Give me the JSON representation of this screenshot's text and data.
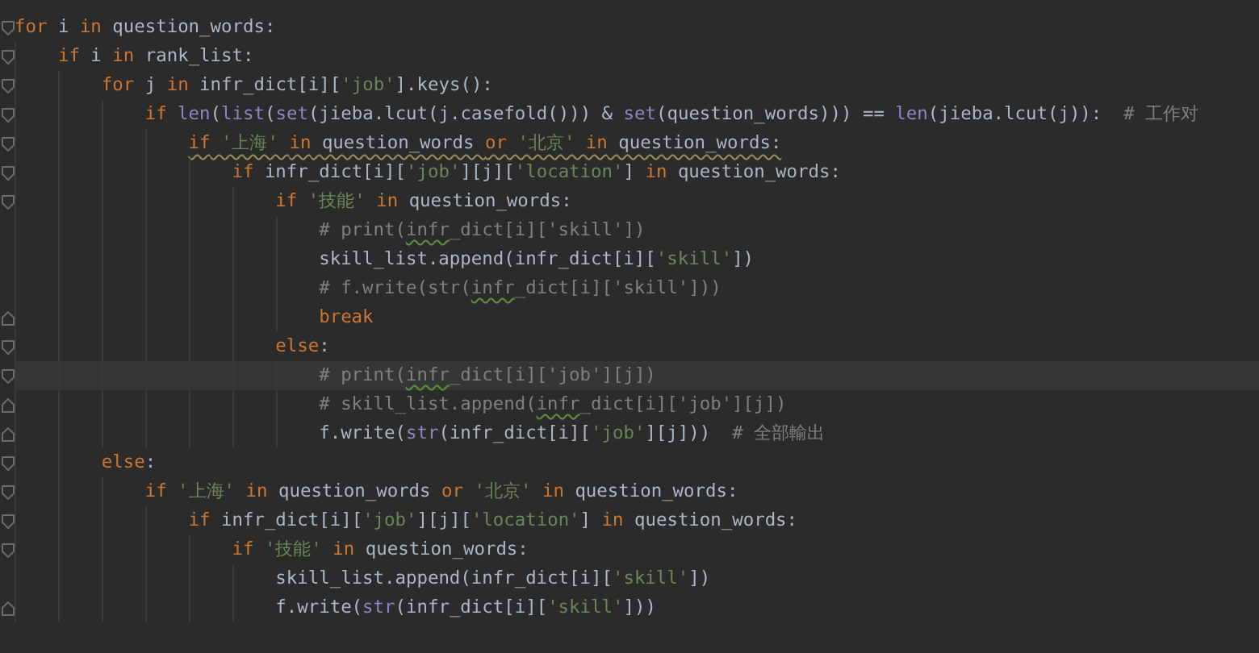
{
  "editor": {
    "lines": [
      {
        "fold_open": true,
        "fold_close": false,
        "tokens": [
          {
            "kind": "kw",
            "text": "for"
          },
          {
            "kind": "id",
            "text": " i "
          },
          {
            "kind": "kw",
            "text": "in"
          },
          {
            "kind": "id",
            "text": " question_words:"
          }
        ]
      },
      {
        "fold_open": true,
        "fold_close": false,
        "tokens": [
          {
            "kind": "kw",
            "text": "    if"
          },
          {
            "kind": "id",
            "text": " i "
          },
          {
            "kind": "kw",
            "text": "in"
          },
          {
            "kind": "id",
            "text": " rank_list:"
          }
        ]
      },
      {
        "fold_open": true,
        "fold_close": false,
        "tokens": [
          {
            "kind": "kw",
            "text": "        for"
          },
          {
            "kind": "id",
            "text": " j "
          },
          {
            "kind": "kw",
            "text": "in"
          },
          {
            "kind": "id",
            "text": " infr_dict[i]["
          },
          {
            "kind": "str",
            "text": "'job'"
          },
          {
            "kind": "id",
            "text": "].keys():"
          }
        ]
      },
      {
        "fold_open": true,
        "fold_close": false,
        "tokens": [
          {
            "kind": "kw",
            "text": "            if"
          },
          {
            "kind": "builtin",
            "text": " len"
          },
          {
            "kind": "id",
            "text": "("
          },
          {
            "kind": "builtin",
            "text": "list"
          },
          {
            "kind": "id",
            "text": "("
          },
          {
            "kind": "builtin",
            "text": "set"
          },
          {
            "kind": "id",
            "text": "(jieba.lcut(j.casefold())) & "
          },
          {
            "kind": "builtin",
            "text": "set"
          },
          {
            "kind": "id",
            "text": "(question_words))) == "
          },
          {
            "kind": "builtin",
            "text": "len"
          },
          {
            "kind": "id",
            "text": "(jieba.lcut(j)):  "
          },
          {
            "kind": "comment",
            "text": "# 工作对"
          }
        ]
      },
      {
        "fold_open": true,
        "fold_close": false,
        "warning": true,
        "tokens": [
          {
            "kind": "kw",
            "text": "                if"
          },
          {
            "kind": "str",
            "text": " '上海' "
          },
          {
            "kind": "kw",
            "text": "in"
          },
          {
            "kind": "id",
            "text": " question_words "
          },
          {
            "kind": "kw",
            "text": "or"
          },
          {
            "kind": "str",
            "text": " '北京' "
          },
          {
            "kind": "kw",
            "text": "in"
          },
          {
            "kind": "id",
            "text": " question_words:"
          }
        ]
      },
      {
        "fold_open": true,
        "fold_close": false,
        "tokens": [
          {
            "kind": "kw",
            "text": "                    if"
          },
          {
            "kind": "id",
            "text": " infr_dict[i]["
          },
          {
            "kind": "str",
            "text": "'job'"
          },
          {
            "kind": "id",
            "text": "][j]["
          },
          {
            "kind": "str",
            "text": "'location'"
          },
          {
            "kind": "id",
            "text": "] "
          },
          {
            "kind": "kw",
            "text": "in"
          },
          {
            "kind": "id",
            "text": " question_words:"
          }
        ]
      },
      {
        "fold_open": true,
        "fold_close": false,
        "tokens": [
          {
            "kind": "kw",
            "text": "                        if"
          },
          {
            "kind": "str",
            "text": " '技能' "
          },
          {
            "kind": "kw",
            "text": "in"
          },
          {
            "kind": "id",
            "text": " question_words:"
          }
        ]
      },
      {
        "fold_open": false,
        "fold_close": false,
        "tokens": [
          {
            "kind": "comment",
            "text": "                            # print("
          },
          {
            "kind": "typo",
            "text": "infr"
          },
          {
            "kind": "comment",
            "text": "_dict[i]['skill'])"
          }
        ]
      },
      {
        "fold_open": false,
        "fold_close": false,
        "tokens": [
          {
            "kind": "id",
            "text": "                            skill_list.append(infr_dict[i]["
          },
          {
            "kind": "str",
            "text": "'skill'"
          },
          {
            "kind": "id",
            "text": "])"
          }
        ]
      },
      {
        "fold_open": false,
        "fold_close": false,
        "tokens": [
          {
            "kind": "comment",
            "text": "                            # f.write(str("
          },
          {
            "kind": "typo",
            "text": "infr"
          },
          {
            "kind": "comment",
            "text": "_dict[i]['skill']))"
          }
        ]
      },
      {
        "fold_open": false,
        "fold_close": true,
        "tokens": [
          {
            "kind": "kw",
            "text": "                            break"
          }
        ]
      },
      {
        "fold_open": true,
        "fold_close": false,
        "tokens": [
          {
            "kind": "kw",
            "text": "                        else"
          },
          {
            "kind": "id",
            "text": ":"
          }
        ]
      },
      {
        "fold_open": true,
        "fold_close": false,
        "current": true,
        "tokens": [
          {
            "kind": "comment",
            "text": "                            # print("
          },
          {
            "kind": "typo",
            "text": "infr"
          },
          {
            "kind": "comment",
            "text": "_dict[i]['job'][j])"
          }
        ]
      },
      {
        "fold_open": false,
        "fold_close": true,
        "tokens": [
          {
            "kind": "comment",
            "text": "                            # skill_list.append("
          },
          {
            "kind": "typo",
            "text": "infr"
          },
          {
            "kind": "comment",
            "text": "_dict[i]['job'][j])"
          }
        ]
      },
      {
        "fold_open": false,
        "fold_close": true,
        "tokens": [
          {
            "kind": "id",
            "text": "                            f.write("
          },
          {
            "kind": "builtin",
            "text": "str"
          },
          {
            "kind": "id",
            "text": "(infr_dict[i]["
          },
          {
            "kind": "str",
            "text": "'job'"
          },
          {
            "kind": "id",
            "text": "][j]))  "
          },
          {
            "kind": "comment",
            "text": "# 全部輸出"
          }
        ]
      },
      {
        "fold_open": true,
        "fold_close": false,
        "tokens": [
          {
            "kind": "kw",
            "text": "        else"
          },
          {
            "kind": "id",
            "text": ":"
          }
        ]
      },
      {
        "fold_open": true,
        "fold_close": false,
        "tokens": [
          {
            "kind": "kw",
            "text": "            if"
          },
          {
            "kind": "str",
            "text": " '上海' "
          },
          {
            "kind": "kw",
            "text": "in"
          },
          {
            "kind": "id",
            "text": " question_words "
          },
          {
            "kind": "kw",
            "text": "or"
          },
          {
            "kind": "str",
            "text": " '北京' "
          },
          {
            "kind": "kw",
            "text": "in"
          },
          {
            "kind": "id",
            "text": " question_words:"
          }
        ]
      },
      {
        "fold_open": true,
        "fold_close": false,
        "tokens": [
          {
            "kind": "kw",
            "text": "                if"
          },
          {
            "kind": "id",
            "text": " infr_dict[i]["
          },
          {
            "kind": "str",
            "text": "'job'"
          },
          {
            "kind": "id",
            "text": "][j]["
          },
          {
            "kind": "str",
            "text": "'location'"
          },
          {
            "kind": "id",
            "text": "] "
          },
          {
            "kind": "kw",
            "text": "in"
          },
          {
            "kind": "id",
            "text": " question_words:"
          }
        ]
      },
      {
        "fold_open": true,
        "fold_close": false,
        "tokens": [
          {
            "kind": "kw",
            "text": "                    if"
          },
          {
            "kind": "str",
            "text": " '技能' "
          },
          {
            "kind": "kw",
            "text": "in"
          },
          {
            "kind": "id",
            "text": " question_words:"
          }
        ]
      },
      {
        "fold_open": false,
        "fold_close": false,
        "tokens": [
          {
            "kind": "id",
            "text": "                        skill_list.append(infr_dict[i]["
          },
          {
            "kind": "str",
            "text": "'skill'"
          },
          {
            "kind": "id",
            "text": "])"
          }
        ]
      },
      {
        "fold_open": false,
        "fold_close": true,
        "tokens": [
          {
            "kind": "id",
            "text": "                        f.write("
          },
          {
            "kind": "builtin",
            "text": "str"
          },
          {
            "kind": "id",
            "text": "(infr_dict[i]["
          },
          {
            "kind": "str",
            "text": "'skill'"
          },
          {
            "kind": "id",
            "text": "]))"
          }
        ]
      }
    ]
  }
}
